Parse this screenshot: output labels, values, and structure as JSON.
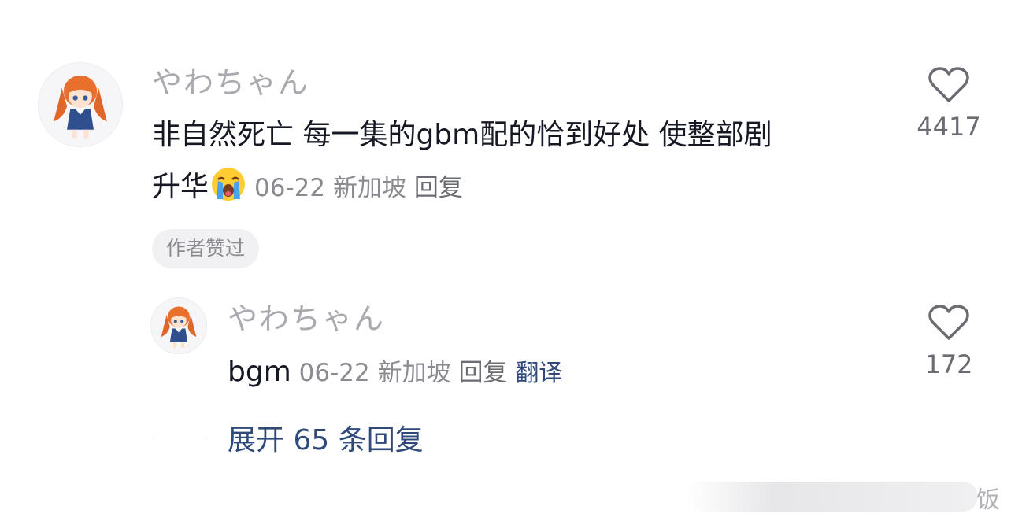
{
  "comment": {
    "username": "やわちゃん",
    "text_line1": "非自然死亡 每一集的gbm配的恰到好处 使整部剧",
    "text_line2": "升华",
    "emoji": "loudly-crying-face",
    "date": "06-22",
    "location": "新加坡",
    "reply_label": "回复",
    "like_count": "4417",
    "badge": "作者赞过"
  },
  "reply": {
    "username": "やわちゃん",
    "text": "bgm",
    "date": "06-22",
    "location": "新加坡",
    "reply_label": "回复",
    "translate_label": "翻译",
    "like_count": "172"
  },
  "expand": {
    "label": "展开 65 条回复"
  },
  "watermark": {
    "char": "饭"
  },
  "colors": {
    "username": "#a9a9b0",
    "meta": "#8a8b91",
    "link_blue": "#2f4a7a",
    "text": "#161823"
  }
}
